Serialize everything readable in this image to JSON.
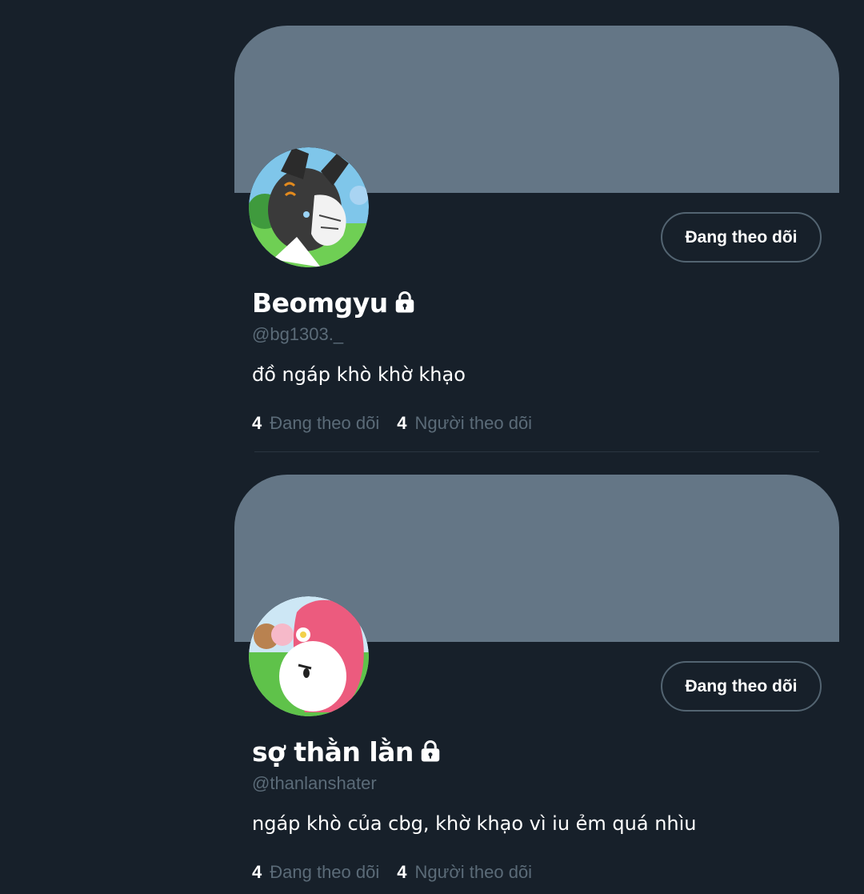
{
  "profiles": [
    {
      "display_name": "Beomgyu",
      "handle": "@bg1303._",
      "bio": "đồ ngáp khò khờ khạo",
      "follow_button": "Đang theo dõi",
      "following_count": "4",
      "following_label": "Đang theo dõi",
      "followers_count": "4",
      "followers_label": "Người theo dõi"
    },
    {
      "display_name": "sợ thằn lằn",
      "handle": "@thanlanshater",
      "bio": "ngáp khò của cbg, khờ khạo vì iu ẻm quá nhìu",
      "follow_button": "Đang theo dõi",
      "following_count": "4",
      "following_label": "Đang theo dõi",
      "followers_count": "4",
      "followers_label": "Người theo dõi"
    }
  ],
  "colors": {
    "background": "#17202a",
    "banner": "#647686",
    "muted_text": "#5b6b78",
    "button_border": "#536471"
  },
  "icons": [
    "lock-icon"
  ]
}
